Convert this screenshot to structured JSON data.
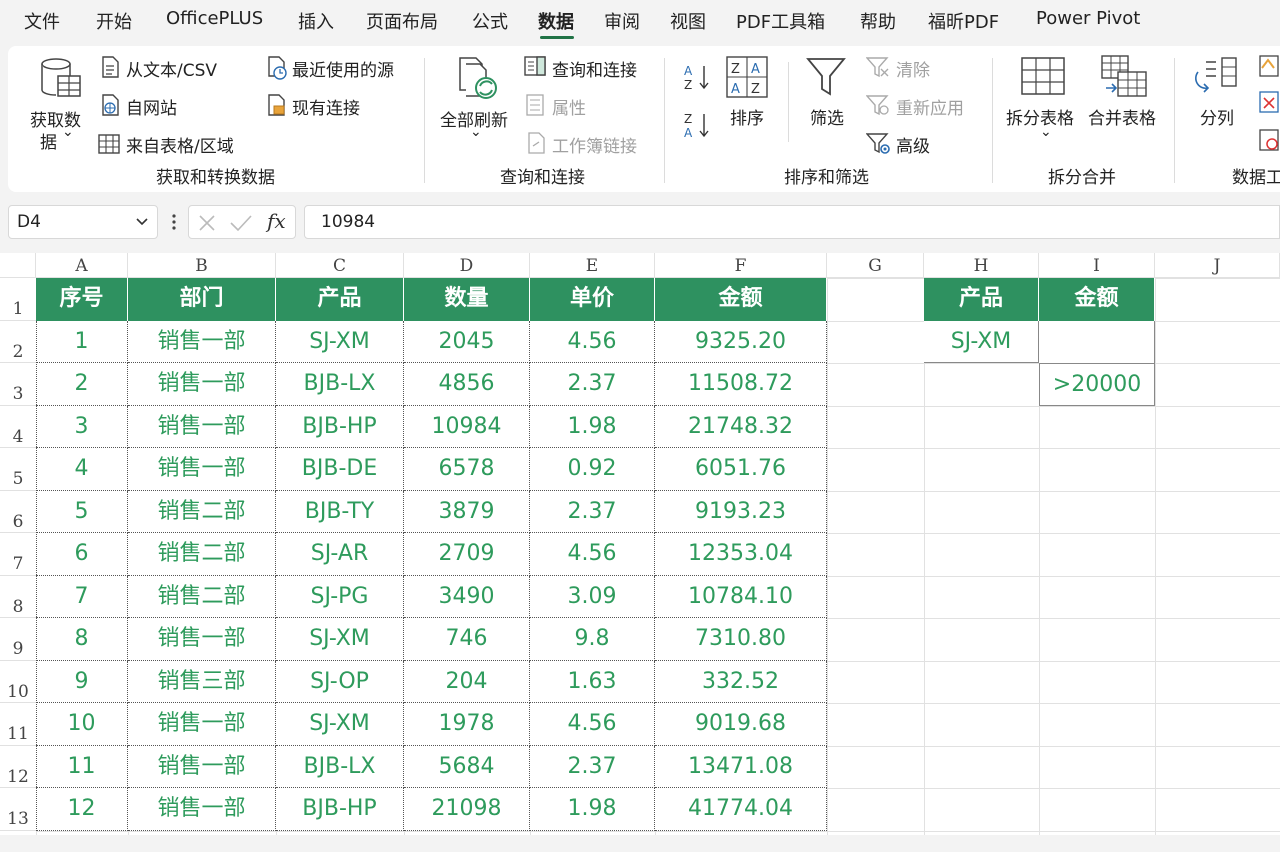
{
  "menu": {
    "tabs": [
      "文件",
      "开始",
      "OfficePLUS",
      "插入",
      "页面布局",
      "公式",
      "数据",
      "审阅",
      "视图",
      "PDF工具箱",
      "帮助",
      "福昕PDF",
      "Power Pivot"
    ],
    "active": "数据"
  },
  "ribbon": {
    "get_data": {
      "line1": "获取数",
      "line2": "据",
      "arrow": "⌄"
    },
    "from_text_csv": "从文本/CSV",
    "from_web": "自网站",
    "from_table": "来自表格/区域",
    "recent_sources": "最近使用的源",
    "existing_connections": "现有连接",
    "group_get_transform": "获取和转换数据",
    "refresh_all": "全部刷新",
    "refresh_arrow": "⌄",
    "queries_connections": "查询和连接",
    "properties": "属性",
    "workbook_links": "工作簿链接",
    "group_queries": "查询和连接",
    "sort": "排序",
    "filter": "筛选",
    "clear": "清除",
    "reapply": "重新应用",
    "advanced": "高级",
    "group_sort_filter": "排序和筛选",
    "split_table": "拆分表格",
    "split_arrow": "⌄",
    "merge_table": "合并表格",
    "group_split_merge": "拆分合并",
    "text_to_columns": "分列",
    "group_data_tools": "数据工"
  },
  "formula_bar": {
    "name_box": "D4",
    "fx": "fx",
    "value": "10984"
  },
  "columns": [
    "A",
    "B",
    "C",
    "D",
    "E",
    "F",
    "G",
    "H",
    "I",
    "J"
  ],
  "rows": [
    "1",
    "2",
    "3",
    "4",
    "5",
    "6",
    "7",
    "8",
    "9",
    "10",
    "11",
    "12",
    "13"
  ],
  "table": {
    "headers": [
      "序号",
      "部门",
      "产品",
      "数量",
      "单价",
      "金额"
    ],
    "rows": [
      [
        "1",
        "销售一部",
        "SJ-XM",
        "2045",
        "4.56",
        "9325.20"
      ],
      [
        "2",
        "销售一部",
        "BJB-LX",
        "4856",
        "2.37",
        "11508.72"
      ],
      [
        "3",
        "销售一部",
        "BJB-HP",
        "10984",
        "1.98",
        "21748.32"
      ],
      [
        "4",
        "销售一部",
        "BJB-DE",
        "6578",
        "0.92",
        "6051.76"
      ],
      [
        "5",
        "销售二部",
        "BJB-TY",
        "3879",
        "2.37",
        "9193.23"
      ],
      [
        "6",
        "销售二部",
        "SJ-AR",
        "2709",
        "4.56",
        "12353.04"
      ],
      [
        "7",
        "销售二部",
        "SJ-PG",
        "3490",
        "3.09",
        "10784.10"
      ],
      [
        "8",
        "销售一部",
        "SJ-XM",
        "746",
        "9.8",
        "7310.80"
      ],
      [
        "9",
        "销售三部",
        "SJ-OP",
        "204",
        "1.63",
        "332.52"
      ],
      [
        "10",
        "销售一部",
        "SJ-XM",
        "1978",
        "4.56",
        "9019.68"
      ],
      [
        "11",
        "销售一部",
        "BJB-LX",
        "5684",
        "2.37",
        "13471.08"
      ],
      [
        "12",
        "销售一部",
        "BJB-HP",
        "21098",
        "1.98",
        "41774.04"
      ]
    ]
  },
  "criteria": {
    "headers": [
      "产品",
      "金额"
    ],
    "h2": "SJ-XM",
    "i3": ">20000"
  },
  "colors": {
    "accent": "#2e9160",
    "text_green": "#2e9b5c"
  }
}
